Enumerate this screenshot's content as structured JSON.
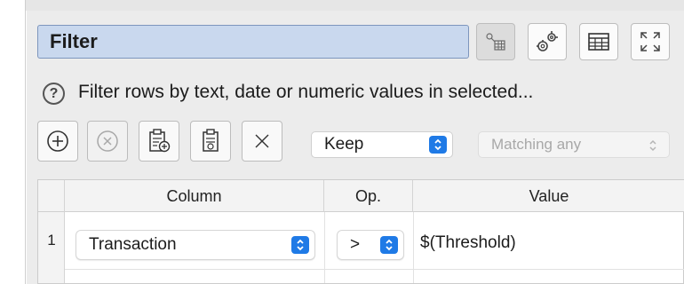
{
  "header": {
    "title": "Filter",
    "buttons": [
      {
        "name": "node-icon-button",
        "icon": "node-table-icon"
      },
      {
        "name": "settings-button",
        "icon": "gears-icon"
      },
      {
        "name": "table-view-button",
        "icon": "table-icon"
      },
      {
        "name": "expand-button",
        "icon": "expand-arrows-icon"
      }
    ]
  },
  "description": {
    "icon": "help-icon",
    "text": "Filter rows by text, date or numeric values in selected..."
  },
  "toolbar": {
    "buttons": [
      {
        "name": "add-row-button",
        "icon": "plus-circle-icon"
      },
      {
        "name": "remove-row-button",
        "icon": "x-circle-icon"
      },
      {
        "name": "paste-add-button",
        "icon": "clipboard-add-icon"
      },
      {
        "name": "paste-button",
        "icon": "clipboard-icon"
      },
      {
        "name": "clear-button",
        "icon": "x-icon"
      }
    ],
    "mode_select": {
      "value": "Keep"
    },
    "match_select": {
      "value": "Matching any"
    }
  },
  "table": {
    "headers": {
      "column": "Column",
      "op": "Op.",
      "value": "Value"
    },
    "rows": [
      {
        "num": "1",
        "column": "Transaction",
        "op": ">",
        "value": "$(Threshold)"
      }
    ]
  },
  "colors": {
    "title_bg": "#c9d8ee",
    "title_border": "#7d96bd",
    "accent": "#1f7ae6",
    "panel_bg": "#ececec"
  }
}
